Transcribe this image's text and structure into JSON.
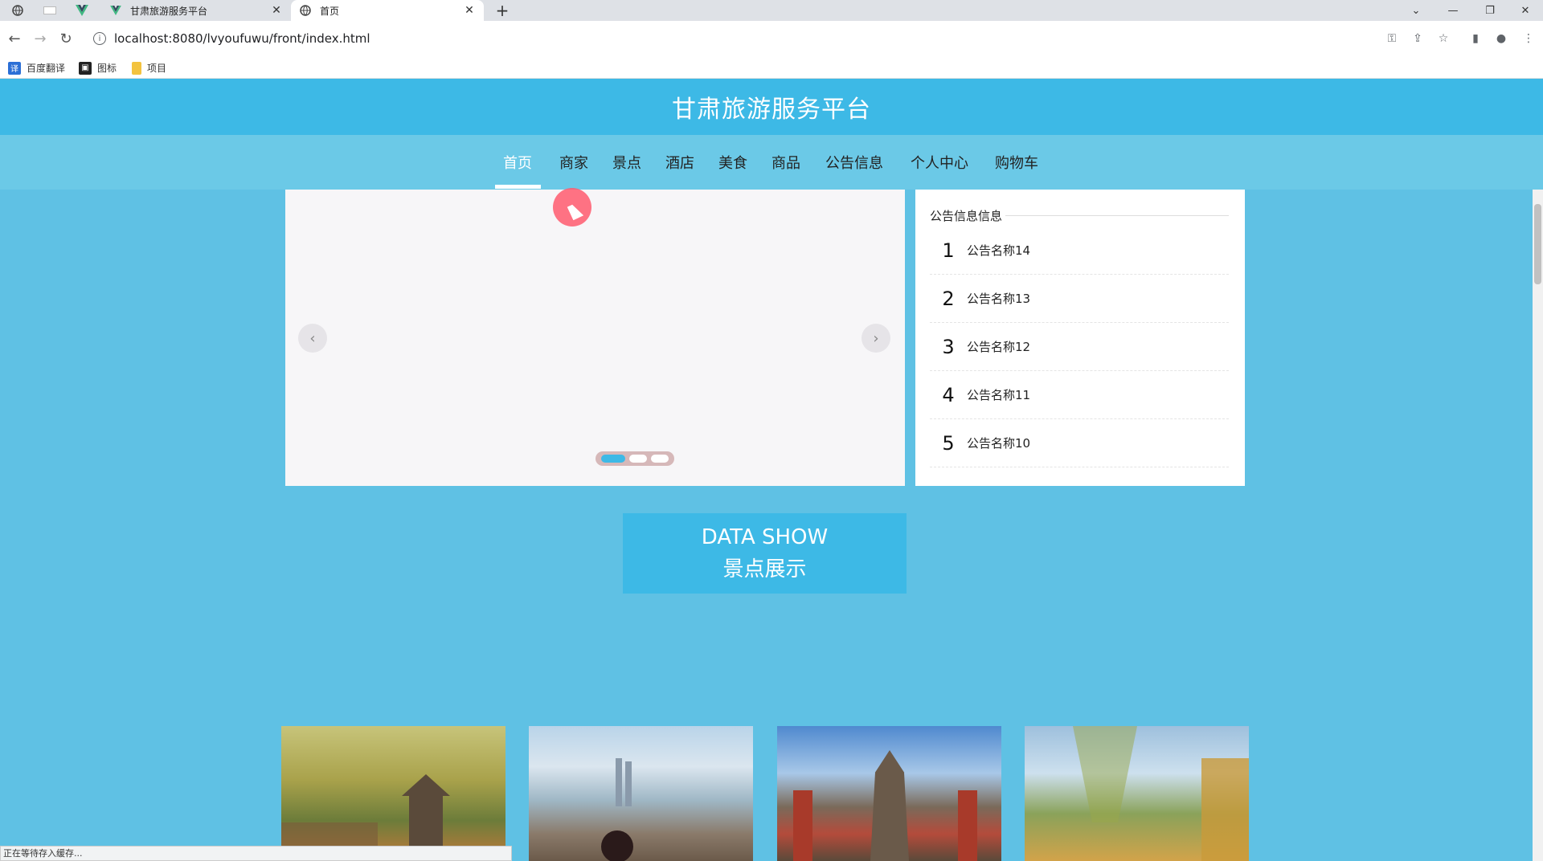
{
  "browser": {
    "tabs": [
      {
        "title": "甘肃旅游服务平台",
        "active": false
      },
      {
        "title": "首页",
        "active": true
      }
    ],
    "new_tab_icon": "plus-icon",
    "url": "localhost:8080/lvyoufuwu/front/index.html",
    "bookmarks": [
      {
        "label": "百度翻译",
        "color": "#2b6fd6"
      },
      {
        "label": "图标",
        "color": "#222222"
      },
      {
        "label": "项目",
        "color": "#f3c33f"
      }
    ],
    "status": "正在等待存入缓存..."
  },
  "site": {
    "title": "甘肃旅游服务平台",
    "accent": "#3db9e6",
    "nav": [
      {
        "label": "首页",
        "active": true
      },
      {
        "label": "商家"
      },
      {
        "label": "景点"
      },
      {
        "label": "酒店"
      },
      {
        "label": "美食"
      },
      {
        "label": "商品"
      },
      {
        "label": "公告信息"
      },
      {
        "label": "个人中心"
      },
      {
        "label": "购物车"
      }
    ]
  },
  "carousel": {
    "slide_count": 3,
    "active_slide": 1
  },
  "notice": {
    "heading": "公告信息信息",
    "items": [
      {
        "num": "1",
        "title": "公告名称14"
      },
      {
        "num": "2",
        "title": "公告名称13"
      },
      {
        "num": "3",
        "title": "公告名称12"
      },
      {
        "num": "4",
        "title": "公告名称11"
      },
      {
        "num": "5",
        "title": "公告名称10"
      }
    ]
  },
  "datashow": {
    "line1": "DATA SHOW",
    "line2": "景点展示"
  }
}
